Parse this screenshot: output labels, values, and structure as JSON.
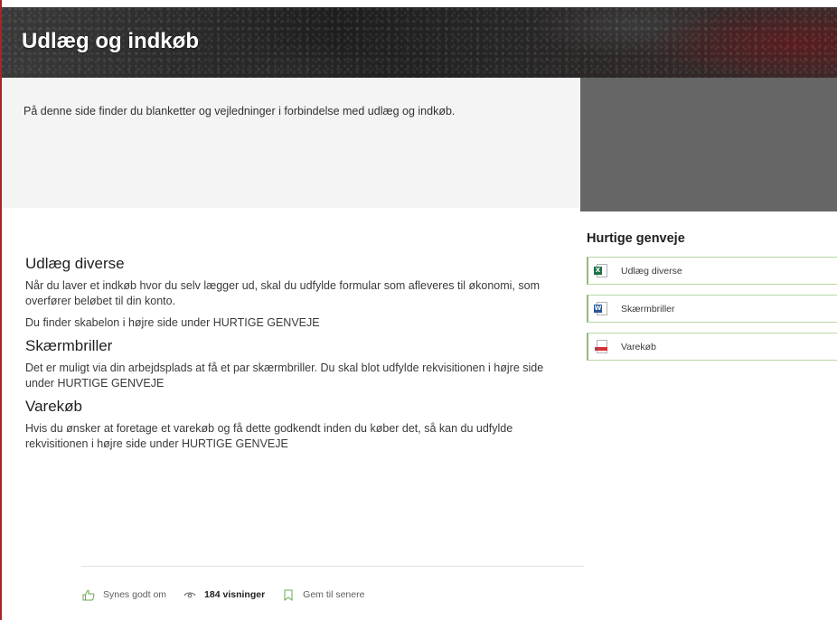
{
  "hero": {
    "title": "Udlæg og indkøb"
  },
  "intro": {
    "text": "På denne side finder du blanketter og vejledninger i forbindelse med udlæg og indkøb."
  },
  "sections": [
    {
      "heading": "Udlæg diverse",
      "paragraphs": [
        "Når du laver et indkøb hvor du selv lægger ud, skal du udfylde formular som afleveres til økonomi, som overfører beløbet til din konto.",
        "Du finder skabelon i højre side under HURTIGE GENVEJE"
      ]
    },
    {
      "heading": "Skærmbriller",
      "paragraphs": [
        "Det er muligt via din arbejdsplads at få et par skærmbriller. Du skal blot udfylde rekvisitionen i højre side under HURTIGE GENVEJE"
      ]
    },
    {
      "heading": "Varekøb",
      "paragraphs": [
        "Hvis du ønsker at foretage et varekøb og få dette godkendt inden du køber det, så kan du udfylde rekvisitionen i højre side under HURTIGE GENVEJE"
      ]
    }
  ],
  "quick_links": {
    "heading": "Hurtige genveje",
    "items": [
      {
        "label": "Udlæg diverse",
        "icon": "excel-file-icon",
        "badge": "X"
      },
      {
        "label": "Skærmbriller",
        "icon": "word-file-icon",
        "badge": "W"
      },
      {
        "label": "Varekøb",
        "icon": "pdf-file-icon"
      }
    ]
  },
  "footer": {
    "like_label": "Synes godt om",
    "views_label": "184 visninger",
    "save_label": "Gem til senere"
  },
  "colors": {
    "accent_border": "#a4262c",
    "quick_link_border": "#8cbf6e",
    "intro_bg": "#f4f4f4",
    "image_placeholder": "#666666"
  }
}
